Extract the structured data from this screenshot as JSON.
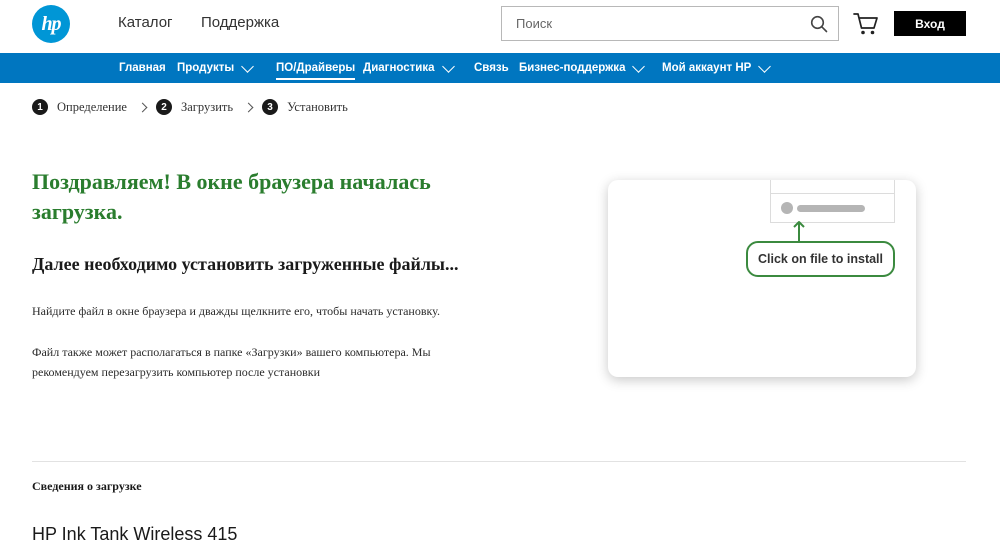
{
  "header": {
    "logo_text": "hp",
    "catalog": "Каталог",
    "support": "Поддержка",
    "search_placeholder": "Поиск",
    "login": "Вход"
  },
  "nav": {
    "items": [
      {
        "label": "Главная",
        "has_dropdown": false
      },
      {
        "label": "Продукты",
        "has_dropdown": true
      },
      {
        "label": "ПО/Драйверы",
        "has_dropdown": false,
        "active": true
      },
      {
        "label": "Диагностика",
        "has_dropdown": true
      },
      {
        "label": "Связь",
        "has_dropdown": false
      },
      {
        "label": "Бизнес-поддержка",
        "has_dropdown": true
      },
      {
        "label": "Мой аккаунт HP",
        "has_dropdown": true
      }
    ]
  },
  "steps": [
    {
      "num": "1",
      "label": "Определение"
    },
    {
      "num": "2",
      "label": "Загрузить"
    },
    {
      "num": "3",
      "label": "Установить"
    }
  ],
  "main": {
    "headline": "Поздравляем! В окне браузера началась загрузка.",
    "subhead": "Далее необходимо установить загруженные файлы...",
    "para1": "Найдите файл в окне браузера и дважды щелкните его, чтобы начать установку.",
    "para2": "Файл также может располагаться в папке «Загрузки» вашего компьютера. Мы рекомендуем перезагрузить компьютер после установки"
  },
  "illustration": {
    "pill_text": "Click on file to install"
  },
  "details": {
    "title": "Сведения о загрузке",
    "product": "HP Ink Tank Wireless 415"
  },
  "colors": {
    "brand_blue": "#0096d6",
    "nav_blue": "#0076c0",
    "headline_green": "#2a7d2e"
  }
}
